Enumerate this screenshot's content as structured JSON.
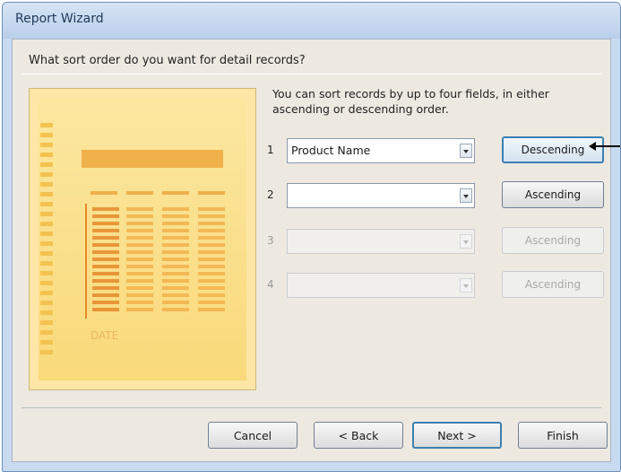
{
  "window": {
    "title": "Report Wizard"
  },
  "question": "What sort order do you want for detail records?",
  "instructions": "You can sort records by up to four fields, in either ascending or descending order.",
  "sort_rows": [
    {
      "number": "1",
      "field": "Product Name",
      "order": "Descending",
      "enabled": true
    },
    {
      "number": "2",
      "field": "",
      "order": "Ascending",
      "enabled": true
    },
    {
      "number": "3",
      "field": "",
      "order": "Ascending",
      "enabled": false
    },
    {
      "number": "4",
      "field": "",
      "order": "Ascending",
      "enabled": false
    }
  ],
  "buttons": {
    "cancel": "Cancel",
    "back": "< Back",
    "next": "Next >",
    "finish": "Finish"
  },
  "preview": {
    "date_text": "DATE"
  },
  "colors": {
    "accent": "#3c7fb1",
    "preview_orange": "#f0b04a"
  },
  "icons": [
    "dropdown-arrow-icon",
    "callout-arrow-icon"
  ]
}
